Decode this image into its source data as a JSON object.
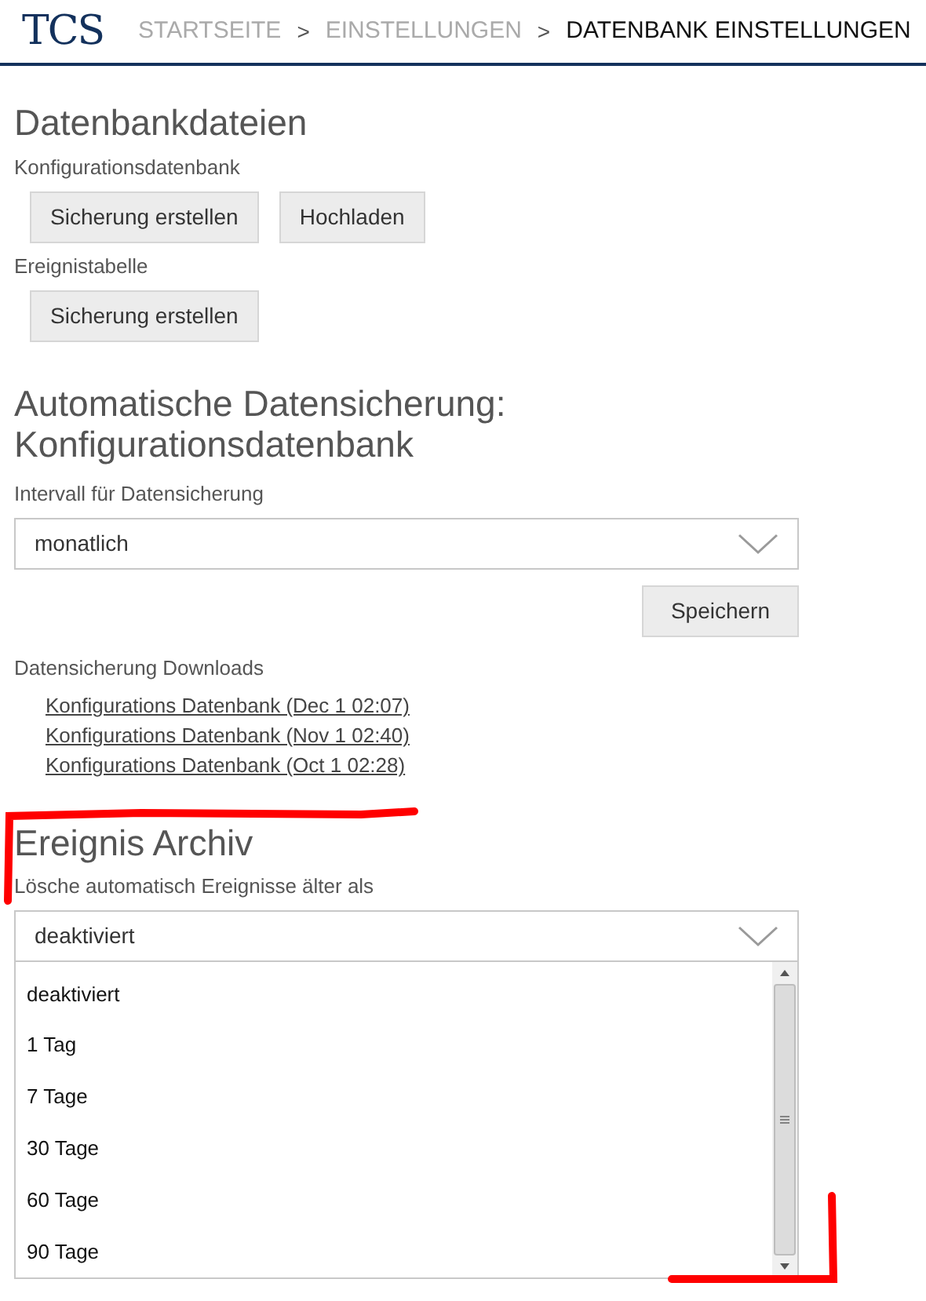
{
  "header": {
    "logo": "TCS",
    "breadcrumbs": [
      {
        "label": "STARTSEITE",
        "current": false
      },
      {
        "label": "EINSTELLUNGEN",
        "current": false
      },
      {
        "label": "DATENBANK EINSTELLUNGEN",
        "current": true
      }
    ],
    "separator": ">"
  },
  "database_files": {
    "title": "Datenbankdateien",
    "groups": [
      {
        "label": "Konfigurationsdatenbank",
        "buttons": [
          "Sicherung erstellen",
          "Hochladen"
        ]
      },
      {
        "label": "Ereignistabelle",
        "buttons": [
          "Sicherung erstellen"
        ]
      }
    ]
  },
  "auto_backup": {
    "title_lines": [
      "Automatische Datensicherung:",
      "Konfigurationsdatenbank"
    ],
    "interval_label": "Intervall für Datensicherung",
    "interval_value": "monatlich",
    "save_button": "Speichern",
    "downloads_label": "Datensicherung Downloads",
    "downloads": [
      "Konfigurations Datenbank (Dec 1 02:07)",
      "Konfigurations Datenbank (Nov 1 02:40)",
      "Konfigurations Datenbank (Oct 1 02:28)"
    ]
  },
  "event_archive": {
    "title": "Ereignis Archiv",
    "label": "Lösche automatisch Ereignisse älter als",
    "value": "deaktiviert",
    "expanded": true,
    "options": [
      "deaktiviert",
      "1 Tag",
      "7 Tage",
      "30 Tage",
      "60 Tage",
      "90 Tage"
    ]
  }
}
